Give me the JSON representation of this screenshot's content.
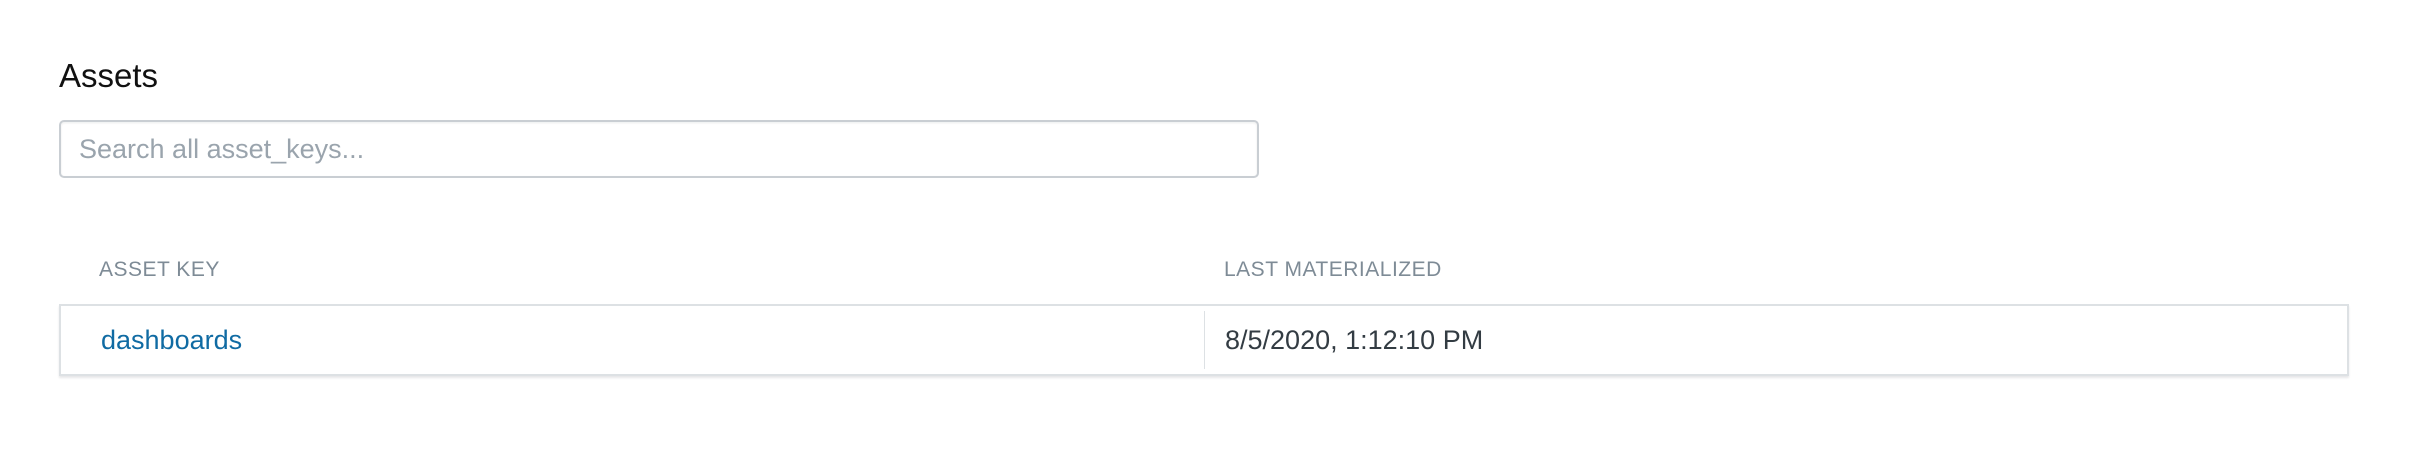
{
  "page": {
    "title": "Assets"
  },
  "search": {
    "placeholder": "Search all asset_keys...",
    "value": ""
  },
  "table": {
    "columns": {
      "asset_key": "ASSET KEY",
      "last_materialized": "LAST MATERIALIZED"
    },
    "rows": [
      {
        "asset_key": "dashboards",
        "last_materialized": "8/5/2020, 1:12:10 PM"
      }
    ]
  },
  "colors": {
    "link": "#106ba3",
    "header_text": "#7e8b96",
    "border": "#dde1e4"
  }
}
